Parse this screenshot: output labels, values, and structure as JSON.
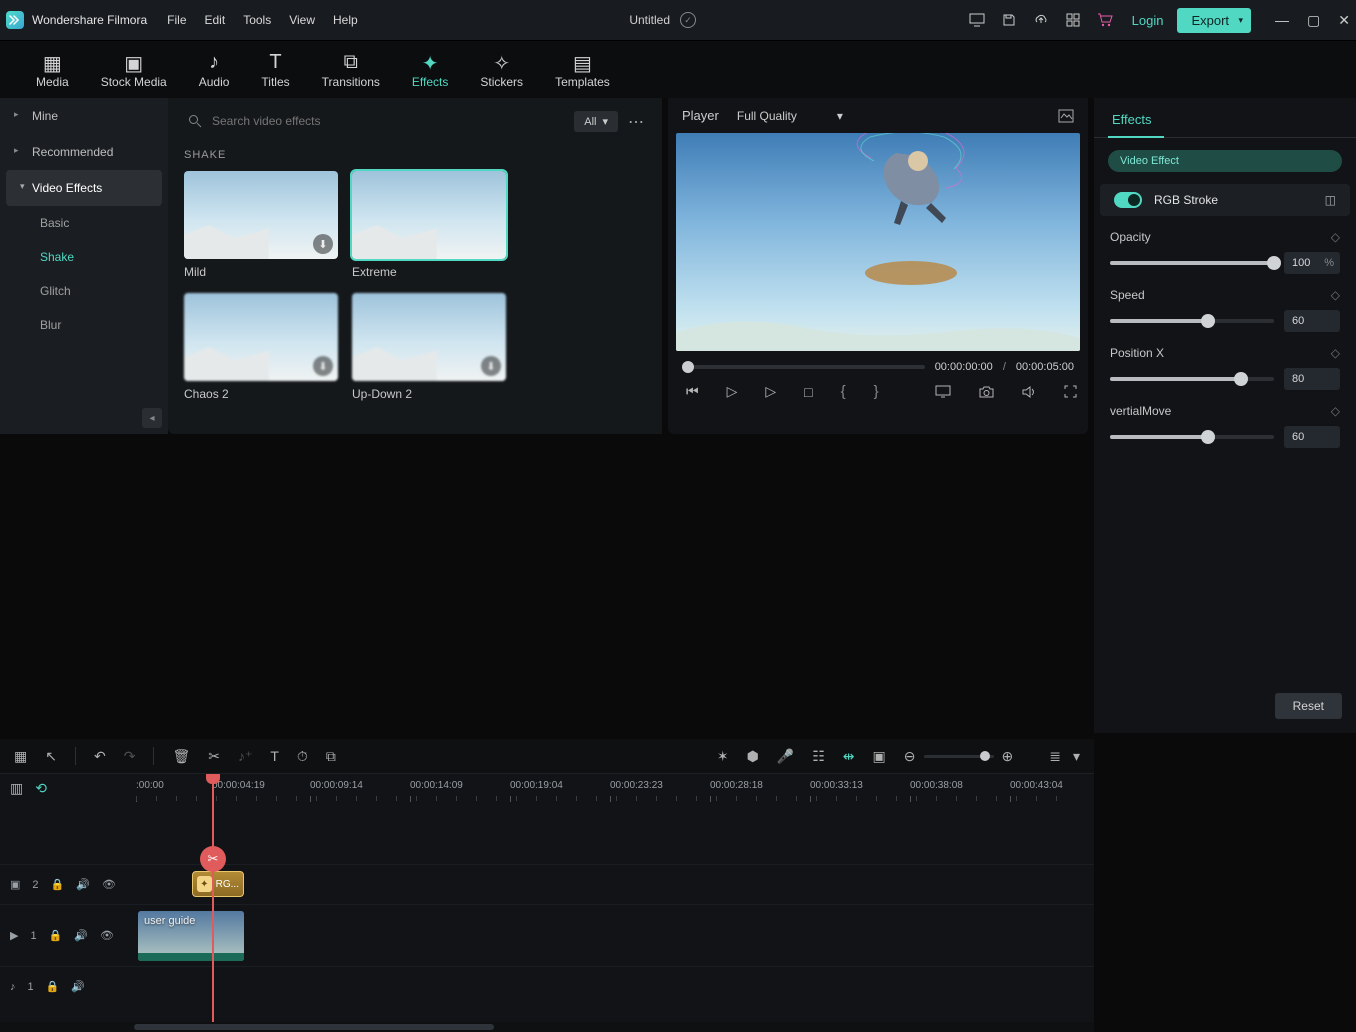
{
  "app": {
    "name": "Wondershare Filmora",
    "title": "Untitled"
  },
  "menu": [
    "File",
    "Edit",
    "Tools",
    "View",
    "Help"
  ],
  "titlebar": {
    "login": "Login",
    "export": "Export"
  },
  "tabs": [
    {
      "id": "media",
      "label": "Media"
    },
    {
      "id": "stock",
      "label": "Stock Media"
    },
    {
      "id": "audio",
      "label": "Audio"
    },
    {
      "id": "titles",
      "label": "Titles"
    },
    {
      "id": "transitions",
      "label": "Transitions"
    },
    {
      "id": "effects",
      "label": "Effects"
    },
    {
      "id": "stickers",
      "label": "Stickers"
    },
    {
      "id": "templates",
      "label": "Templates"
    }
  ],
  "sidebar": {
    "items": [
      {
        "label": "Mine",
        "hasChildren": true
      },
      {
        "label": "Recommended",
        "hasChildren": true
      },
      {
        "label": "Video Effects",
        "hasChildren": true,
        "selected": true
      }
    ],
    "subs": [
      {
        "label": "Basic"
      },
      {
        "label": "Shake",
        "active": true
      },
      {
        "label": "Glitch"
      },
      {
        "label": "Blur"
      }
    ]
  },
  "browser": {
    "placeholder": "Search video effects",
    "filter": "All",
    "section": "SHAKE",
    "thumbs": [
      {
        "label": "Mild"
      },
      {
        "label": "Extreme",
        "selected": true
      },
      {
        "label": "Chaos 2"
      },
      {
        "label": "Up-Down 2"
      }
    ]
  },
  "player": {
    "label": "Player",
    "quality": "Full Quality",
    "current": "00:00:00:00",
    "total": "00:00:05:00",
    "sep": "/"
  },
  "props": {
    "tab": "Effects",
    "pill": "Video Effect",
    "effect_name": "RGB Stroke",
    "rows": [
      {
        "label": "Opacity",
        "value": "100",
        "unit": "%",
        "pct": 100
      },
      {
        "label": "Speed",
        "value": "60",
        "pct": 60
      },
      {
        "label": "Position X",
        "value": "80",
        "pct": 80
      },
      {
        "label": "vertialMove",
        "value": "60",
        "pct": 60
      }
    ],
    "reset": "Reset"
  },
  "timeline": {
    "playhead_label": "00:00:04:19",
    "ticks": [
      ":00:00",
      "00:00:04:19",
      "00:00:09:14",
      "00:00:14:09",
      "00:00:19:04",
      "00:00:23:23",
      "00:00:28:18",
      "00:00:33:13",
      "00:00:38:08",
      "00:00:43:04"
    ],
    "tracks": {
      "effect": {
        "label": "2",
        "clip": "RG..."
      },
      "video": {
        "label": "1",
        "clip": "user guide"
      },
      "audio": {
        "label": "1"
      }
    }
  }
}
